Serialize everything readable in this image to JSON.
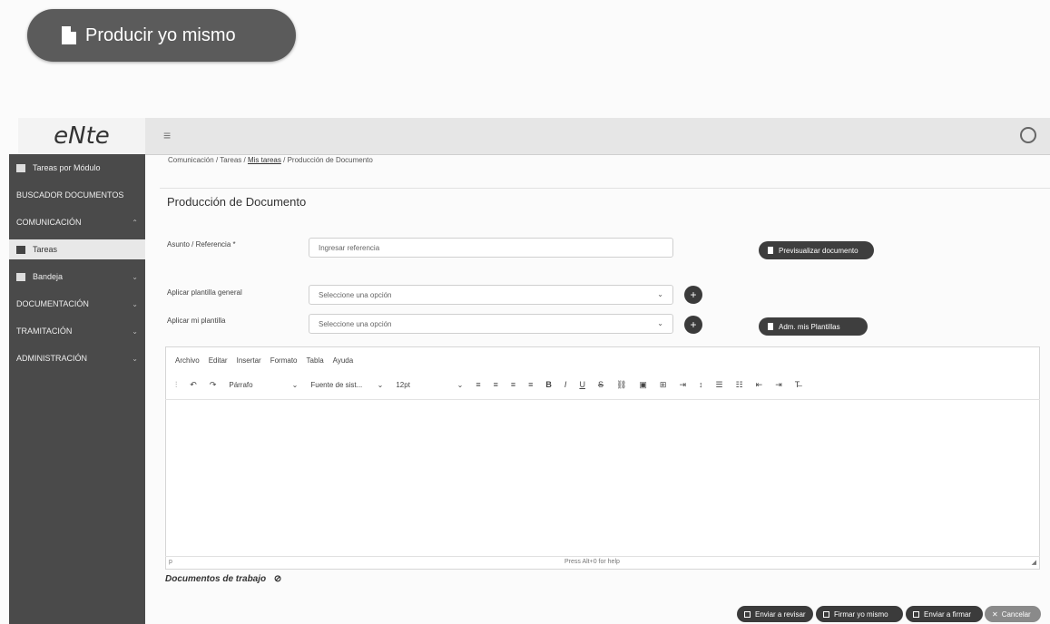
{
  "banner": {
    "label": "Producir yo mismo"
  },
  "app": {
    "brand": "eNte"
  },
  "sidebar": {
    "items": [
      {
        "label": "Tareas por Módulo"
      },
      {
        "label": "BUSCADOR DOCUMENTOS"
      },
      {
        "label": "COMUNICACIÓN"
      },
      {
        "label": "Tareas"
      },
      {
        "label": "Bandeja"
      },
      {
        "label": "DOCUMENTACIÓN"
      },
      {
        "label": "TRAMITACIÓN"
      },
      {
        "label": "ADMINISTRACIÓN"
      }
    ]
  },
  "breadcrumb": {
    "part1": "Comunicación",
    "sep": "/",
    "part2": "Tareas",
    "part3": "Mis tareas",
    "part4": "Producción de Documento"
  },
  "page": {
    "title": "Producción de Documento"
  },
  "form": {
    "subject_label": "Asunto / Referencia *",
    "subject_placeholder": "Ingresar referencia",
    "preview_button": "Previsualizar documento",
    "general_template_label": "Aplicar plantilla general",
    "general_template_value": "Seleccione una opción",
    "my_template_label": "Aplicar mi plantilla",
    "my_template_value": "Seleccione una opción",
    "manage_templates_button": "Adm. mis Plantillas"
  },
  "editor": {
    "menu": [
      "Archivo",
      "Editar",
      "Insertar",
      "Formato",
      "Tabla",
      "Ayuda"
    ],
    "block_format": "Párrafo",
    "font_family": "Fuente de sist...",
    "font_size": "12pt",
    "path": "p",
    "status_hint": "Press Alt+0 for help"
  },
  "docs": {
    "label": "Documentos de trabajo"
  },
  "actions": {
    "send_review": "Enviar a revisar",
    "sign_myself": "Firmar yo mismo",
    "send_sign": "Enviar a firmar",
    "cancel": "Cancelar"
  }
}
